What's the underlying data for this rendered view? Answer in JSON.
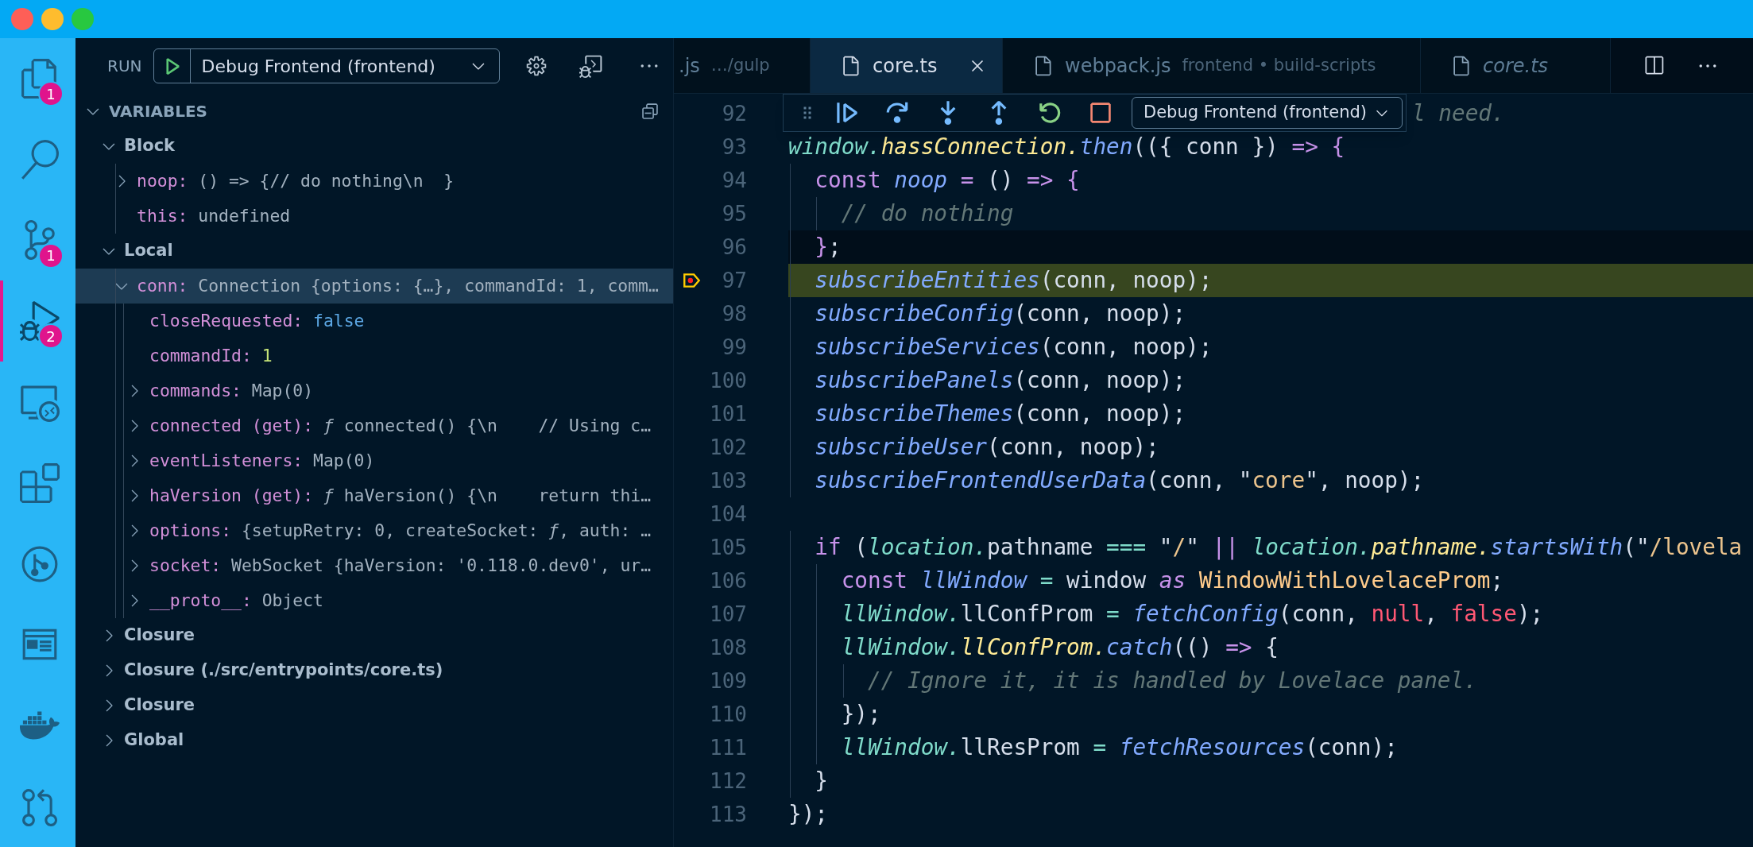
{
  "activity_bar": [
    {
      "selected": false,
      "badge": "1"
    },
    {
      "selected": false
    },
    {
      "selected": false,
      "badge": "1"
    },
    {
      "selected": true,
      "badge": "2"
    },
    {
      "selected": false
    },
    {
      "selected": false
    },
    {
      "selected": false
    },
    {
      "selected": false
    },
    {
      "selected": false
    },
    {
      "selected": false
    }
  ],
  "sidebar": {
    "title": "RUN",
    "configuration": "Debug Frontend (frontend)",
    "variables": {
      "title": "VARIABLES",
      "scopes": [
        {
          "name": "Block",
          "expanded": true,
          "children": [
            {
              "name": "noop:",
              "value": "() => {// do nothing\\n  }",
              "kind": "plain",
              "expanded": false,
              "selected": false
            },
            {
              "name": "this:",
              "value": "undefined",
              "kind": "plain",
              "selected": false
            }
          ]
        },
        {
          "name": "Local",
          "expanded": true,
          "children": [
            {
              "name": "conn:",
              "value": "Connection {options: {…}, commandId: 1, comm…",
              "kind": "plain",
              "expanded": true,
              "selected": true,
              "children": [
                {
                  "name": "closeRequested:",
                  "value": "false",
                  "kind": "boolean",
                  "selected": false
                },
                {
                  "name": "commandId:",
                  "value": "1",
                  "kind": "number",
                  "selected": false
                },
                {
                  "name": "commands:",
                  "value": "Map(0)",
                  "kind": "plain",
                  "expanded": false,
                  "selected": false
                },
                {
                  "name": "connected (get):",
                  "value": "*ƒ* connected() {\\n    // Using c…",
                  "kind": "plain",
                  "expanded": false,
                  "selected": false
                },
                {
                  "name": "eventListeners:",
                  "value": "Map(0)",
                  "kind": "plain",
                  "expanded": false,
                  "selected": false
                },
                {
                  "name": "haVersion (get):",
                  "value": "*ƒ* haVersion() {\\n    return thi…",
                  "kind": "plain",
                  "expanded": false,
                  "selected": false
                },
                {
                  "name": "options:",
                  "value": "{setupRetry: 0, createSocket: *ƒ*, auth: …",
                  "kind": "plain",
                  "expanded": false,
                  "selected": false
                },
                {
                  "name": "socket:",
                  "value": "WebSocket {haVersion: '0.118.0.dev0', ur…",
                  "kind": "plain",
                  "expanded": false,
                  "selected": false
                },
                {
                  "name": "__proto__:",
                  "value": "Object",
                  "kind": "plain",
                  "expanded": false,
                  "selected": false
                }
              ]
            }
          ]
        },
        {
          "name": "Closure",
          "expanded": false
        },
        {
          "name": "Closure (./src/entrypoints/core.ts)",
          "expanded": false
        },
        {
          "name": "Closure",
          "expanded": false
        },
        {
          "name": "Global",
          "expanded": false
        }
      ]
    }
  },
  "tabs": [
    {
      "label": ".js",
      "description": "…/gulp",
      "kind": "clipped",
      "selected": false,
      "preview": false
    },
    {
      "label": "core.ts",
      "kind": "file",
      "selected": true,
      "preview": false
    },
    {
      "label": "webpack.js",
      "description": "frontend • build-scripts",
      "kind": "file",
      "selected": false,
      "preview": false
    },
    {
      "label": "core.ts",
      "kind": "file",
      "selected": false,
      "preview": true
    }
  ],
  "debug_toolbar": {
    "configuration": "Debug Frontend (frontend)"
  },
  "editor": {
    "lines": [
      {
        "number": "92",
        "covered": true,
        "tokens": [
          {
            "text": "l need.",
            "kind": "comment"
          }
        ]
      },
      {
        "number": "93",
        "tokens": [
          {
            "text": "window.",
            "kind": "variable"
          },
          {
            "text": "hassConnection.",
            "kind": "property"
          },
          {
            "text": "then",
            "kind": "function"
          },
          {
            "text": "(({ conn }) ",
            "kind": "plain"
          },
          {
            "text": "=> {",
            "kind": "keyword"
          }
        ]
      },
      {
        "number": "94",
        "tokens": [
          {
            "text": "  const ",
            "kind": "keyword"
          },
          {
            "text": "noop",
            "kind": "function"
          },
          {
            "text": " = ",
            "kind": "keyword"
          },
          {
            "text": "() ",
            "kind": "plain"
          },
          {
            "text": "=> {",
            "kind": "keyword"
          }
        ]
      },
      {
        "number": "95",
        "tokens": [
          {
            "text": "    // do nothing",
            "kind": "comment"
          }
        ]
      },
      {
        "number": "96",
        "cursor": true,
        "tokens": [
          {
            "text": "  }",
            "kind": "keyword"
          },
          {
            "text": ";",
            "kind": "plain"
          }
        ]
      },
      {
        "number": "97",
        "current": true,
        "tokens": [
          {
            "text": "  subscribeEntities",
            "kind": "function"
          },
          {
            "text": "(conn, noop);",
            "kind": "plain"
          }
        ]
      },
      {
        "number": "98",
        "tokens": [
          {
            "text": "  subscribeConfig",
            "kind": "function"
          },
          {
            "text": "(conn, noop);",
            "kind": "plain"
          }
        ]
      },
      {
        "number": "99",
        "tokens": [
          {
            "text": "  subscribeServices",
            "kind": "function"
          },
          {
            "text": "(conn, noop);",
            "kind": "plain"
          }
        ]
      },
      {
        "number": "100",
        "tokens": [
          {
            "text": "  subscribePanels",
            "kind": "function"
          },
          {
            "text": "(conn, noop);",
            "kind": "plain"
          }
        ]
      },
      {
        "number": "101",
        "tokens": [
          {
            "text": "  subscribeThemes",
            "kind": "function"
          },
          {
            "text": "(conn, noop);",
            "kind": "plain"
          }
        ]
      },
      {
        "number": "102",
        "tokens": [
          {
            "text": "  subscribeUser",
            "kind": "function"
          },
          {
            "text": "(conn, noop);",
            "kind": "plain"
          }
        ]
      },
      {
        "number": "103",
        "tokens": [
          {
            "text": "  subscribeFrontendUserData",
            "kind": "function"
          },
          {
            "text": "(conn, \"",
            "kind": "plain"
          },
          {
            "text": "core",
            "kind": "string"
          },
          {
            "text": "\", noop);",
            "kind": "plain"
          }
        ]
      },
      {
        "number": "104"
      },
      {
        "number": "105",
        "tokens": [
          {
            "text": "  if",
            "kind": "keyword"
          },
          {
            "text": " (",
            "kind": "plain"
          },
          {
            "text": "location.",
            "kind": "variable"
          },
          {
            "text": "pathname",
            "kind": "plain"
          },
          {
            "text": " === ",
            "kind": "operator"
          },
          {
            "text": "\"",
            "kind": "plain"
          },
          {
            "text": "/",
            "kind": "string"
          },
          {
            "text": "\" ",
            "kind": "plain"
          },
          {
            "text": "|| ",
            "kind": "keyword"
          },
          {
            "text": "location.",
            "kind": "variable"
          },
          {
            "text": "pathname.",
            "kind": "property"
          },
          {
            "text": "startsWith",
            "kind": "function"
          },
          {
            "text": "(\"",
            "kind": "plain"
          },
          {
            "text": "/lovela",
            "kind": "string"
          }
        ]
      },
      {
        "number": "106",
        "tokens": [
          {
            "text": "    const ",
            "kind": "keyword"
          },
          {
            "text": "llWindow",
            "kind": "function"
          },
          {
            "text": " = ",
            "kind": "operator"
          },
          {
            "text": "window ",
            "kind": "plain"
          },
          {
            "text": "as",
            "kind": "keyword_italic"
          },
          {
            "text": " WindowWithLovelaceProm",
            "kind": "type"
          },
          {
            "text": ";",
            "kind": "plain"
          }
        ]
      },
      {
        "number": "107",
        "tokens": [
          {
            "text": "    llWindow.",
            "kind": "variable"
          },
          {
            "text": "llConfProm",
            "kind": "plain"
          },
          {
            "text": " = ",
            "kind": "operator"
          },
          {
            "text": "fetchConfig",
            "kind": "function"
          },
          {
            "text": "(conn, ",
            "kind": "plain"
          },
          {
            "text": "null",
            "kind": "literal"
          },
          {
            "text": ", ",
            "kind": "plain"
          },
          {
            "text": "false",
            "kind": "literal"
          },
          {
            "text": ");",
            "kind": "plain"
          }
        ]
      },
      {
        "number": "108",
        "tokens": [
          {
            "text": "    llWindow.",
            "kind": "variable"
          },
          {
            "text": "llConfProm.",
            "kind": "property"
          },
          {
            "text": "catch",
            "kind": "function"
          },
          {
            "text": "(() ",
            "kind": "plain"
          },
          {
            "text": "=>",
            "kind": "keyword"
          },
          {
            "text": " {",
            "kind": "plain"
          }
        ]
      },
      {
        "number": "109",
        "tokens": [
          {
            "text": "      // Ignore it, it is handled by Lovelace panel.",
            "kind": "comment"
          }
        ]
      },
      {
        "number": "110",
        "tokens": [
          {
            "text": "    });",
            "kind": "plain"
          }
        ]
      },
      {
        "number": "111",
        "tokens": [
          {
            "text": "    llWindow.",
            "kind": "variable"
          },
          {
            "text": "llResProm",
            "kind": "plain"
          },
          {
            "text": " = ",
            "kind": "operator"
          },
          {
            "text": "fetchResources",
            "kind": "function"
          },
          {
            "text": "(conn);",
            "kind": "plain"
          }
        ]
      },
      {
        "number": "112",
        "tokens": [
          {
            "text": "  }",
            "kind": "plain"
          }
        ]
      },
      {
        "number": "113",
        "tokens": [
          {
            "text": "});",
            "kind": "plain"
          }
        ]
      }
    ]
  }
}
